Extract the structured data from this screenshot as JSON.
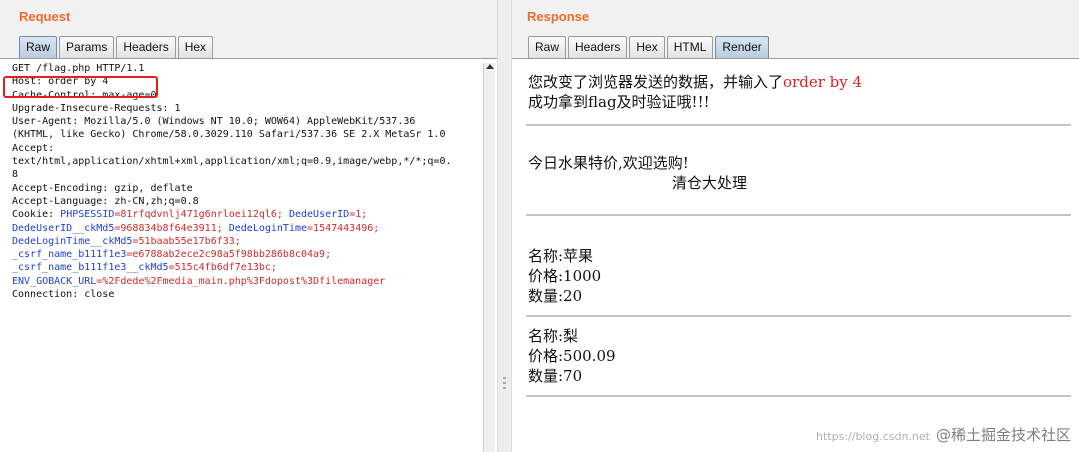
{
  "request": {
    "title": "Request",
    "tabs": [
      {
        "label": "Raw",
        "active": true
      },
      {
        "label": "Params",
        "active": false
      },
      {
        "label": "Headers",
        "active": false
      },
      {
        "label": "Hex",
        "active": false
      }
    ],
    "lines": {
      "l1": "GET /flag.php HTTP/1.1",
      "l2": "Host: order by 4",
      "l3": "Cache-Control: max-age=0",
      "l4": "Upgrade-Insecure-Requests: 1",
      "l5": "User-Agent: Mozilla/5.0 (Windows NT 10.0; WOW64) AppleWebKit/537.36",
      "l6": "(KHTML, like Gecko) Chrome/58.0.3029.110 Safari/537.36 SE 2.X MetaSr 1.0",
      "l7": "Accept:",
      "l8": "text/html,application/xhtml+xml,application/xml;q=0.9,image/webp,*/*;q=0.",
      "l9": "8",
      "l10": "Accept-Encoding: gzip, deflate",
      "l11": "Accept-Language: zh-CN,zh;q=0.8",
      "l12_prefix": "Cookie: ",
      "l12_k1": "PHPSESSID",
      "l12_v1": "=81rfqdvnlj471g6nrloei12ql6; ",
      "l12_k2": "DedeUserID",
      "l12_v2": "=1;",
      "l13_k1": "DedeUserID__ckMd5",
      "l13_v1": "=968834b8f64e3911; ",
      "l13_k2": "DedeLoginTime",
      "l13_v2": "=1547443496;",
      "l14_k1": "DedeLoginTime__ckMd5",
      "l14_v1": "=51baab55e17b6f33;",
      "l15_k1": "_csrf_name_b111f1e3",
      "l15_v1": "=e6788ab2ece2c98a5f98bb286b8c04a9;",
      "l16_k1": "_csrf_name_b111f1e3__ckMd5",
      "l16_v1": "=515c4fb6df7e13bc;",
      "l17_k1": "ENV_GOBACK_URL",
      "l17_v1": "=%2Fdede%2Fmedia_main.php%3Fdopost%3Dfilemanager",
      "l18": "Connection: close"
    }
  },
  "response": {
    "title": "Response",
    "tabs": [
      {
        "label": "Raw",
        "active": false
      },
      {
        "label": "Headers",
        "active": false
      },
      {
        "label": "Hex",
        "active": false
      },
      {
        "label": "HTML",
        "active": false
      },
      {
        "label": "Render",
        "active": true
      }
    ],
    "msg_prefix": "您改变了浏览器发送的数据，并输入了",
    "msg_highlight": "order by 4",
    "msg_line2": "成功拿到flag及时验证哦!!!",
    "promo": "今日水果特价,欢迎选购!",
    "marquee": "清仓大处理",
    "products": [
      {
        "name": "名称:苹果",
        "price": "价格:1000",
        "qty": "数量:20"
      },
      {
        "name": "名称:梨",
        "price": "价格:500.09",
        "qty": "数量:70"
      }
    ]
  },
  "watermark": {
    "url": "https://blog.csdn.net",
    "text": "@稀土掘金技术社区"
  }
}
